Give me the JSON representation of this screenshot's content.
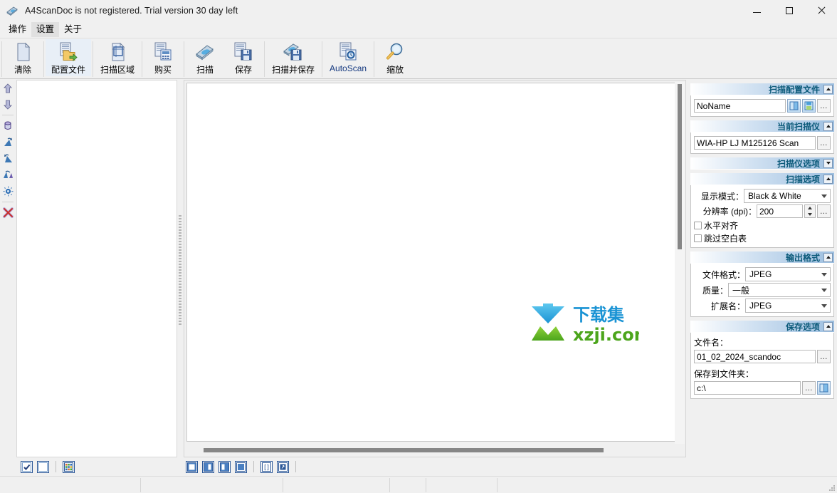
{
  "window": {
    "title": "A4ScanDoc is not registered. Trial version 30 day left",
    "icon": "scanner-icon",
    "minimize_label": "─",
    "maximize_label": "□",
    "close_label": "✕"
  },
  "menu": {
    "items": [
      {
        "label": "操作",
        "name": "menu-operation"
      },
      {
        "label": "设置",
        "name": "menu-settings",
        "hover": true
      },
      {
        "label": "关于",
        "name": "menu-about"
      }
    ]
  },
  "toolbar": {
    "buttons": [
      {
        "label": "清除",
        "icon": "blank-page-icon",
        "name": "toolbar-clear"
      },
      {
        "label": "配置文件",
        "icon": "profile-folder-icon",
        "name": "toolbar-profile",
        "highlighted": true
      },
      {
        "label": "扫描区域",
        "icon": "crop-area-icon",
        "name": "toolbar-scan-area"
      },
      {
        "label": "购买",
        "icon": "buy-document-icon",
        "name": "toolbar-buy"
      },
      {
        "label": "扫描",
        "icon": "scanner-icon",
        "name": "toolbar-scan"
      },
      {
        "label": "保存",
        "icon": "save-document-icon",
        "name": "toolbar-save"
      },
      {
        "label": "扫描并保存",
        "icon": "scan-and-save-icon",
        "name": "toolbar-scan-and-save"
      },
      {
        "label": "AutoScan",
        "icon": "autoscan-icon",
        "name": "toolbar-autoscan",
        "blue": true
      },
      {
        "label": "缩放",
        "icon": "magnifier-icon",
        "name": "toolbar-zoom"
      }
    ]
  },
  "left_strip": {
    "items": [
      {
        "icon": "arrow-up-icon",
        "name": "move-up-button"
      },
      {
        "icon": "arrow-down-icon",
        "name": "move-down-button"
      },
      {
        "icon": "rotate-icon",
        "name": "rotate-button"
      },
      {
        "icon": "rotate-left-icon",
        "name": "rotate-left-button"
      },
      {
        "icon": "rotate-right-icon",
        "name": "rotate-right-button"
      },
      {
        "icon": "flip-icon",
        "name": "flip-button"
      },
      {
        "icon": "brightness-icon",
        "name": "brightness-button"
      },
      {
        "icon": "delete-x-icon",
        "name": "delete-button"
      }
    ]
  },
  "canvas": {
    "watermark": {
      "text_cn": "下载集",
      "text_en": "xzji.com",
      "blue": "#2aa9e0",
      "green": "#6fbe2a",
      "red": "#e8392a"
    }
  },
  "bottom_bar": {
    "left_group": [
      {
        "icon": "checkbox-checked-icon",
        "name": "select-all-button"
      },
      {
        "icon": "checkbox-empty-icon",
        "name": "deselect-all-button"
      },
      {
        "icon": "thumbnail-grid-icon",
        "name": "thumbnail-view-button"
      }
    ],
    "center_group": [
      {
        "icon": "fit-page-icon",
        "name": "view-fit-page-button"
      },
      {
        "icon": "split-left-icon",
        "name": "view-split-left-button"
      },
      {
        "icon": "split-right-icon",
        "name": "view-split-right-button"
      },
      {
        "icon": "full-fill-icon",
        "name": "view-full-button"
      },
      {
        "icon": "fit-width-icon",
        "name": "view-fit-width-button"
      },
      {
        "icon": "fit-height-icon",
        "name": "view-fit-height-button"
      }
    ]
  },
  "status_bar": {
    "cells": [
      "",
      "",
      "",
      "",
      "",
      ""
    ]
  },
  "right_panel": {
    "groups": [
      {
        "name": "scan-profile-group",
        "title": "扫描配置文件",
        "collapse_state": "expanded",
        "profile_value": "NoName",
        "open_button": "open-profile-icon",
        "save_button": "save-profile-icon",
        "more_button": "…"
      },
      {
        "name": "current-scanner-group",
        "title": "当前扫描仪",
        "collapse_state": "expanded",
        "scanner_value": "WIA-HP LJ M125126 Scan",
        "more_button": "…"
      },
      {
        "name": "scanner-options-group",
        "title": "扫描仪选项",
        "collapse_state": "collapsed"
      },
      {
        "name": "scan-options-group",
        "title": "扫描选项",
        "collapse_state": "expanded",
        "display_mode_label": "显示模式：",
        "display_mode_value": "Black & White",
        "resolution_label": "分辨率 (dpi)：",
        "resolution_value": "200",
        "more_button": "…",
        "checkbox_align_label": "水平对齐",
        "checkbox_align_checked": false,
        "checkbox_skip_label": "跳过空白表",
        "checkbox_skip_checked": false
      },
      {
        "name": "output-format-group",
        "title": "输出格式",
        "collapse_state": "expanded",
        "file_format_label": "文件格式：",
        "file_format_value": "JPEG",
        "quality_label": "质量：",
        "quality_value": "一般",
        "extension_label": "扩展名：",
        "extension_value": "JPEG"
      },
      {
        "name": "save-options-group",
        "title": "保存选项",
        "collapse_state": "expanded",
        "filename_label": "文件名：",
        "filename_value": "01_02_2024_scandoc",
        "filename_more_button": "…",
        "folder_label": "保存到文件夹：",
        "folder_value": "c:\\",
        "folder_more_button": "…",
        "folder_browse_button": "open-folder-icon"
      }
    ]
  }
}
